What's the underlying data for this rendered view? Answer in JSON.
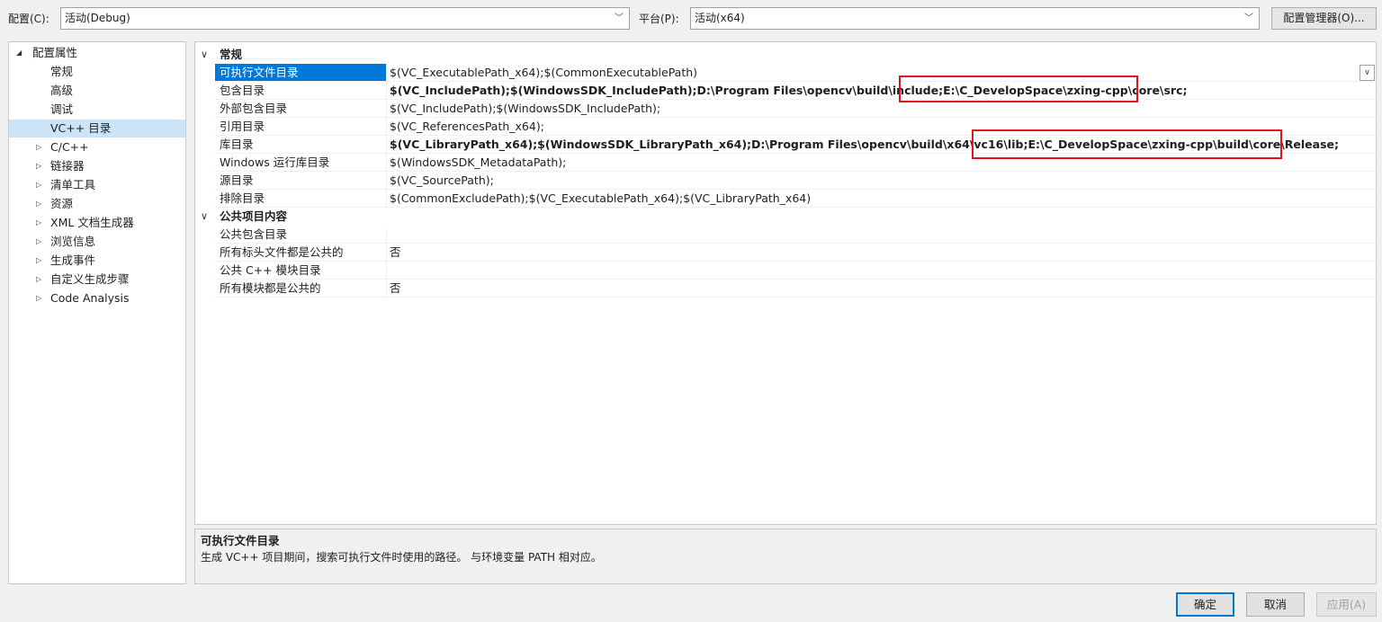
{
  "toolbar": {
    "config_label": "配置(C):",
    "config_value": "活动(Debug)",
    "platform_label": "平台(P):",
    "platform_value": "活动(x64)",
    "config_manager": "配置管理器(O)..."
  },
  "tree": {
    "root": "配置属性",
    "items": [
      "常规",
      "高级",
      "调试",
      "VC++ 目录"
    ],
    "collapsed": [
      "C/C++",
      "链接器",
      "清单工具",
      "资源",
      "XML 文档生成器",
      "浏览信息",
      "生成事件",
      "自定义生成步骤",
      "Code Analysis"
    ]
  },
  "grid": {
    "cat_general": "常规",
    "rows_general": [
      {
        "name": "可执行文件目录",
        "value": "$(VC_ExecutablePath_x64);$(CommonExecutablePath)"
      },
      {
        "name": "包含目录",
        "value": "$(VC_IncludePath);$(WindowsSDK_IncludePath);D:\\Program Files\\opencv\\build\\include;E:\\C_DevelopSpace\\zxing-cpp\\core\\src;"
      },
      {
        "name": "外部包含目录",
        "value": "$(VC_IncludePath);$(WindowsSDK_IncludePath);"
      },
      {
        "name": "引用目录",
        "value": "$(VC_ReferencesPath_x64);"
      },
      {
        "name": "库目录",
        "value": "$(VC_LibraryPath_x64);$(WindowsSDK_LibraryPath_x64);D:\\Program Files\\opencv\\build\\x64\\vc16\\lib;E:\\C_DevelopSpace\\zxing-cpp\\build\\core\\Release;"
      },
      {
        "name": "Windows 运行库目录",
        "value": "$(WindowsSDK_MetadataPath);"
      },
      {
        "name": "源目录",
        "value": "$(VC_SourcePath);"
      },
      {
        "name": "排除目录",
        "value": "$(CommonExcludePath);$(VC_ExecutablePath_x64);$(VC_LibraryPath_x64)"
      }
    ],
    "cat_public": "公共项目内容",
    "rows_public": [
      {
        "name": "公共包含目录",
        "value": ""
      },
      {
        "name": "所有标头文件都是公共的",
        "value": "否"
      },
      {
        "name": "公共 C++ 模块目录",
        "value": ""
      },
      {
        "name": "所有模块都是公共的",
        "value": "否"
      }
    ]
  },
  "description": {
    "title": "可执行文件目录",
    "text": "生成 VC++ 项目期间，搜索可执行文件时使用的路径。 与环境变量 PATH 相对应。"
  },
  "buttons": {
    "ok": "确定",
    "cancel": "取消",
    "apply": "应用(A)"
  }
}
